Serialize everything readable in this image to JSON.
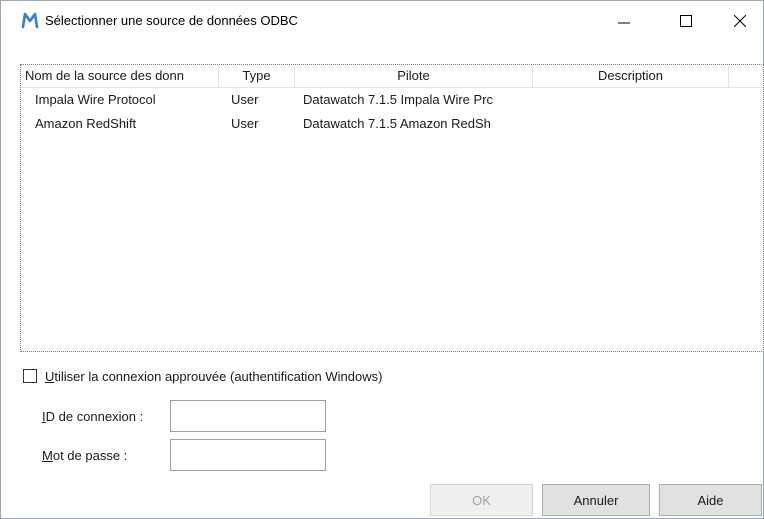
{
  "window": {
    "title": "Sélectionner une source de données ODBC",
    "icon": "m-logo-icon",
    "accent": "#3a7bd5"
  },
  "listview": {
    "columns": [
      "Nom de la source des donn",
      "Type",
      "Pilote",
      "Description"
    ],
    "rows": [
      {
        "name": "Impala Wire Protocol",
        "type": "User",
        "pilote": "Datawatch 7.1.5 Impala Wire Prc",
        "description": ""
      },
      {
        "name": "Amazon RedShift",
        "type": "User",
        "pilote": "Datawatch 7.1.5 Amazon RedSh",
        "description": ""
      }
    ]
  },
  "trusted_connection": {
    "label": "Utiliser la connexion approuvée (authentification Windows)",
    "checked": false
  },
  "login": {
    "id_label": "ID de connexion :",
    "id_value": "",
    "password_label": "Mot de passe :",
    "password_value": ""
  },
  "buttons": {
    "ok": "OK",
    "cancel": "Annuler",
    "help": "Aide"
  }
}
